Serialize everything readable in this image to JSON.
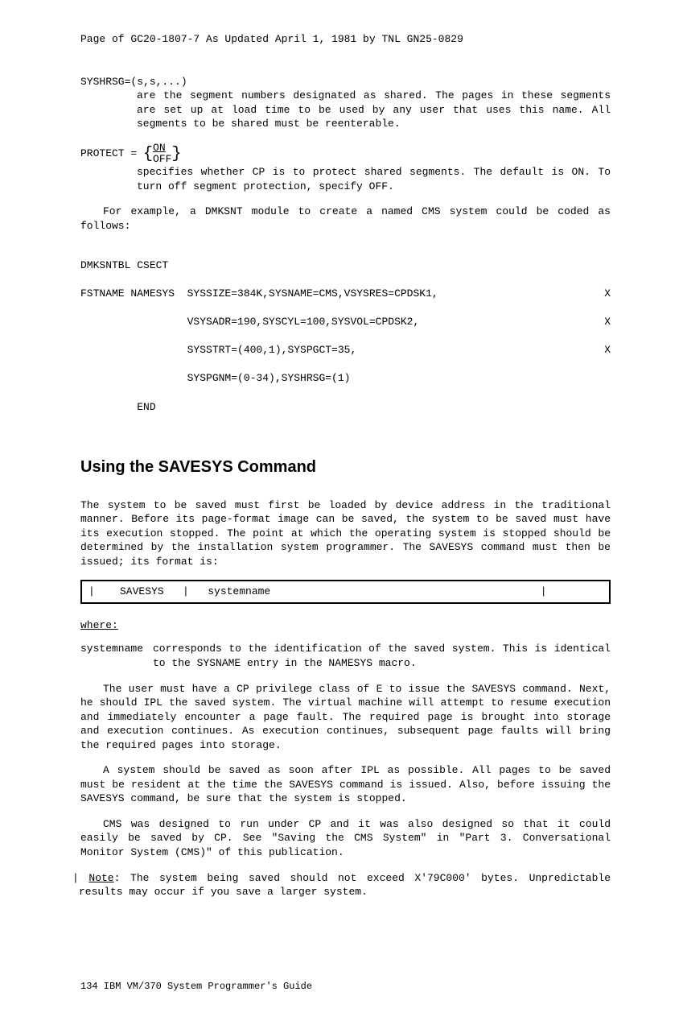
{
  "header": "Page of GC20-1807-7 As Updated April 1, 1981 by TNL GN25-0829",
  "param1": {
    "name": "SYSHRSG=(s,s,...)",
    "desc": "are the segment numbers designated as shared. The pages in these segments are set up at load time to be used by any user that uses this name. All segments to be shared must be reenterable."
  },
  "param2": {
    "name": "PROTECT = ",
    "opt1": "ON",
    "opt2": "OFF",
    "desc": "specifies whether CP is to protect shared segments. The default is ON. To turn off segment protection, specify OFF."
  },
  "intro": "For example, a DMKSNT module to create a named CMS system could be coded as follows:",
  "code": {
    "l1": "DMKSNTBL CSECT",
    "l2a": "FSTNAME NAMESYS  SYSSIZE=384K,SYSNAME=CMS,VSYSRES=CPDSK1,",
    "l2b": "X",
    "l3a": "                 VSYSADR=190,SYSCYL=100,SYSVOL=CPDSK2,",
    "l3b": "X",
    "l4a": "                 SYSSTRT=(400,1),SYSPGCT=35,",
    "l4b": "X",
    "l5": "                 SYSPGNM=(0-34),SYSHRSG=(1)",
    "l6": "         END"
  },
  "section_heading": "Using the SAVESYS Command",
  "p1": "The system to be saved must first be loaded by device address in the traditional manner. Before its page-format image can be saved, the system to be saved must have its execution stopped. The point at which the operating system is stopped should be determined by the installation system programmer. The SAVESYS command must then be issued; its format is:",
  "cmdbox": "|    SAVESYS   |   systemname                                           |",
  "where": "where",
  "def_term": "systemname",
  "def_desc": "corresponds to the identification of the saved system. This is identical to the SYSNAME entry in the NAMESYS macro.",
  "p2": "The user must have a CP privilege class of E to issue the SAVESYS command. Next, he should IPL the saved system. The virtual machine will attempt to resume execution and immediately encounter a page fault. The required page is brought into storage and execution continues. As execution continues, subsequent page faults will bring the required pages into storage.",
  "p3": "A system should be saved as soon after IPL as possible. All pages to be saved must be resident at the time the SAVESYS command is issued. Also, before issuing the SAVESYS command, be sure that the system is stopped.",
  "p4": "CMS was designed to run under CP and it was also designed so that it could easily be saved by CP. See \"Saving the CMS System\" in \"Part 3. Conversational Monitor System (CMS)\" of this publication.",
  "note_label": "Note",
  "note_text": ": The system being saved should not exceed X'79C000' bytes. Unpredictable results may occur if you save a larger system.",
  "footer": "134  IBM VM/370 System Programmer's Guide"
}
